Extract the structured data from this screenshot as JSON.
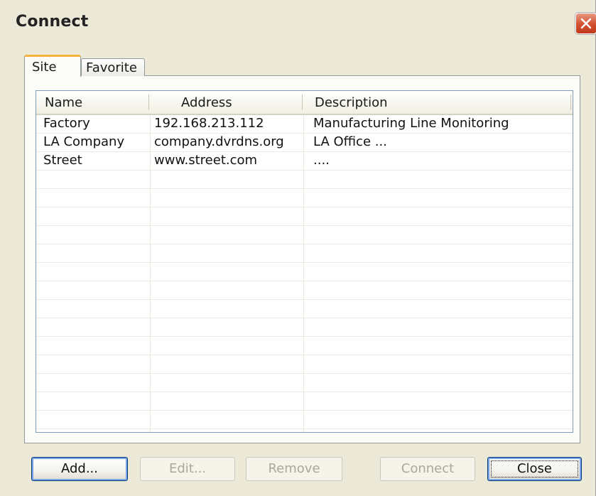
{
  "window": {
    "title": "Connect"
  },
  "tabs": [
    {
      "label": "Site",
      "selected": true
    },
    {
      "label": "Favorite",
      "selected": false
    }
  ],
  "list": {
    "columns": [
      "Name",
      "Address",
      "Description"
    ],
    "rows": [
      [
        "Factory",
        "192.168.213.112",
        "Manufacturing Line Monitoring"
      ],
      [
        "LA Company",
        "company.dvrdns.org",
        "LA Office ..."
      ],
      [
        "Street",
        "www.street.com",
        "...."
      ]
    ]
  },
  "buttons": {
    "add": "Add...",
    "edit": "Edit...",
    "remove": "Remove",
    "connect": "Connect",
    "close": "Close"
  },
  "colors": {
    "dialog_background": "#ece9d8",
    "close_button": "#d2502f",
    "selected_tab_accent": "#f5b23d",
    "disabled_text": "#aca899"
  }
}
